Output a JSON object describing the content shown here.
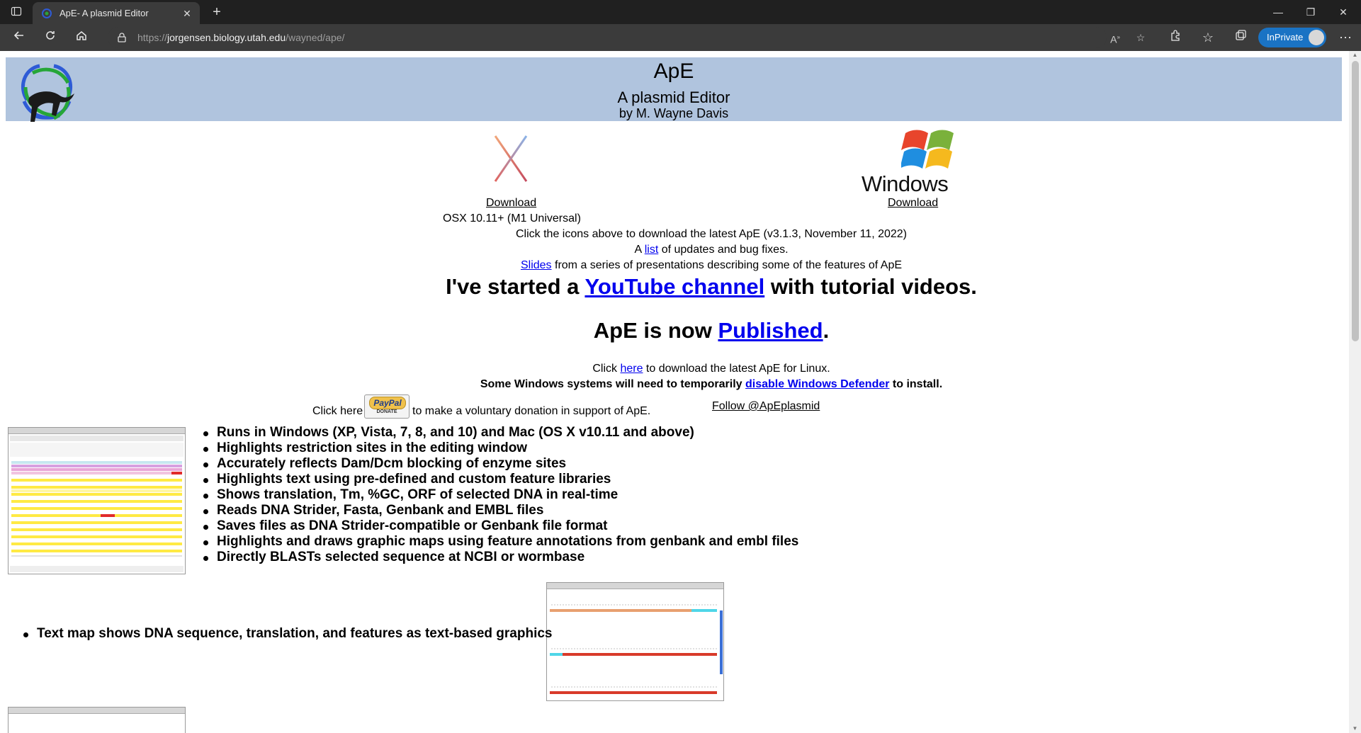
{
  "browser": {
    "tab_title": "ApE- A plasmid Editor",
    "url_scheme": "https://",
    "url_host": "jorgensen.biology.utah.edu",
    "url_path": "/wayned/ape/",
    "inprivate_label": "InPrivate"
  },
  "header": {
    "title": "ApE",
    "subtitle": "A plasmid Editor",
    "author": "by M. Wayne Davis"
  },
  "downloads": {
    "osx_link": "Download",
    "osx_note": "OSX 10.11+ (M1 Universal)",
    "windows_logo_text": "Windows",
    "windows_link": "Download"
  },
  "info": {
    "click_icons": "Click the icons above to download the latest ApE (v3.1.3, November 11, 2022)",
    "list_prefix": "A ",
    "list_link": "list",
    "list_suffix": " of updates and bug fixes.",
    "slides_link": "Slides",
    "slides_suffix": " from a series of presentations describing some of the features of ApE"
  },
  "youtube": {
    "prefix": "I've started a ",
    "link": "YouTube channel",
    "suffix": " with tutorial videos."
  },
  "published": {
    "prefix": "ApE is now ",
    "link": "Published",
    "suffix": "."
  },
  "linux": {
    "prefix": "Click ",
    "link": "here",
    "suffix": " to download the latest ApE for Linux."
  },
  "defender": {
    "prefix": "Some Windows systems will need to temporarily ",
    "link": "disable Windows Defender",
    "suffix": " to install."
  },
  "donate": {
    "prefix": "Click here",
    "paypal_top": "PayPal",
    "paypal_bottom": "DONATE",
    "suffix": "to make a voluntary donation in support of ApE.",
    "follow_link": "Follow @ApEplasmid"
  },
  "features": [
    "Runs in Windows (XP, Vista, 7, 8, and 10) and Mac (OS X v10.11 and above)",
    "Highlights restriction sites in the editing window",
    "Accurately reflects Dam/Dcm blocking of enzyme sites",
    "Highlights text using pre-defined and custom feature libraries",
    "Shows translation, Tm, %GC, ORF of selected DNA in real-time",
    "Reads DNA Strider, Fasta, Genbank and EMBL files",
    "Saves files as DNA Strider-compatible or Genbank file format",
    "Highlights and draws graphic maps using feature annotations from genbank and embl files",
    "Directly BLASTs selected sequence at NCBI or wormbase"
  ],
  "text_map_feature": "Text map shows DNA sequence, translation, and features as text-based graphics",
  "icons": {
    "sidebar": "tab-actions-icon",
    "back": "back-arrow-icon",
    "refresh": "refresh-icon",
    "home": "home-icon",
    "lock": "lock-icon",
    "read_aloud": "read-aloud-icon",
    "favorite": "add-favorite-icon",
    "extensions": "extensions-icon",
    "favorites": "favorites-icon",
    "collections": "collections-icon",
    "more": "more-icon"
  },
  "colors": {
    "banner": "#b0c4de",
    "link": "#0000ee",
    "chrome_dark": "#202020",
    "chrome_toolbar": "#3b3b3b",
    "inprivate": "#1a73c4"
  }
}
